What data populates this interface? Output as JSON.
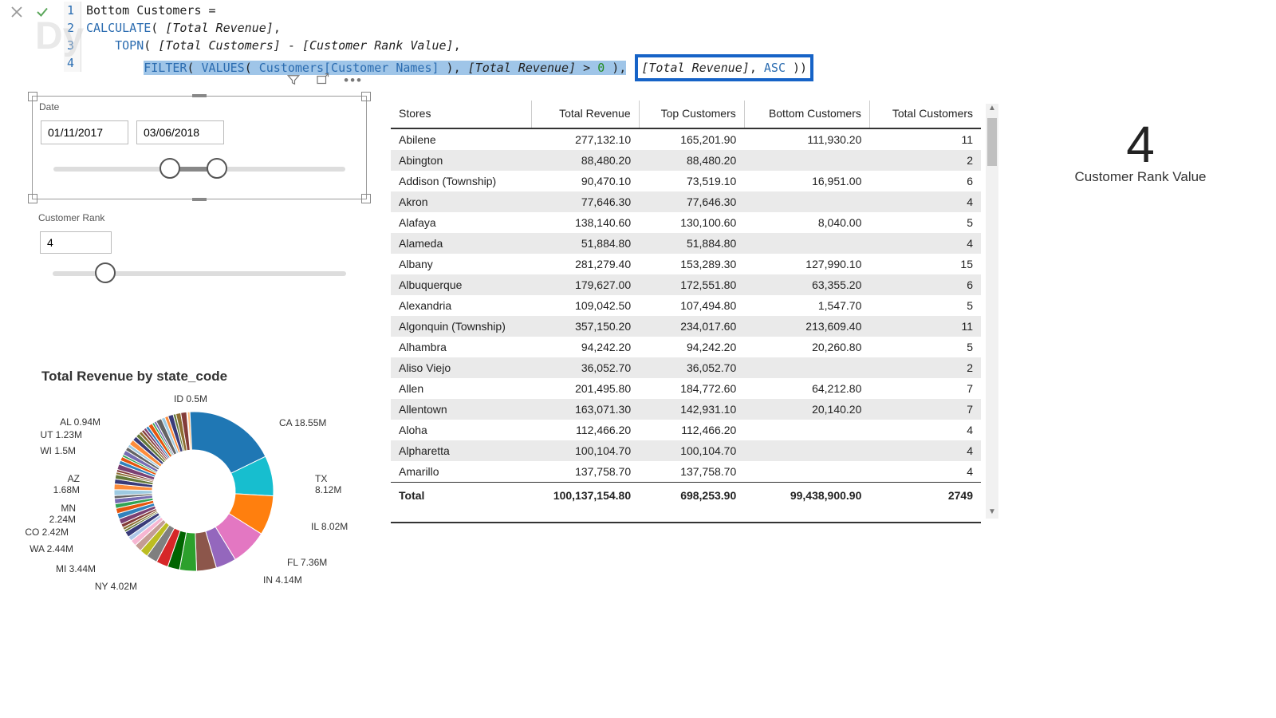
{
  "watermark": "Dy",
  "formula": {
    "line_numbers": [
      "1",
      "2",
      "3",
      "4"
    ],
    "l1_name": "Bottom Customers ",
    "l1_eq": "=",
    "l2_fn": "CALCULATE",
    "l2_paren": "( ",
    "l2_meas": "[Total Revenue]",
    "l2_end": ",",
    "l3_indent": "    ",
    "l3_fn": "TOPN",
    "l3_paren": "( ",
    "l3_a": "[Total Customers]",
    "l3_minus": " - ",
    "l3_b": "[Customer Rank Value]",
    "l3_end": ",",
    "l4_indent": "        ",
    "l4_fn1": "FILTER",
    "l4_p1": "( ",
    "l4_fn2": "VALUES",
    "l4_p2": "( ",
    "l4_col": "Customers[Customer Names]",
    "l4_p2c": " ), ",
    "l4_meas": "[Total Revenue]",
    "l4_gt": " > ",
    "l4_zero": "0",
    "l4_p1c": " ),",
    "l4_box_meas": "[Total Revenue]",
    "l4_box_sep": ", ",
    "l4_box_asc": "ASC",
    "l4_box_end": " ))"
  },
  "slicers": {
    "date_label": "Date",
    "date_from": "01/11/2017",
    "date_to": "03/06/2018",
    "rank_label": "Customer Rank",
    "rank_value": "4"
  },
  "kpi": {
    "value": "4",
    "label": "Customer Rank Value"
  },
  "table": {
    "columns": [
      "Stores",
      "Total Revenue",
      "Top Customers",
      "Bottom Customers",
      "Total Customers"
    ],
    "rows": [
      [
        "Abilene",
        "277,132.10",
        "165,201.90",
        "111,930.20",
        "11"
      ],
      [
        "Abington",
        "88,480.20",
        "88,480.20",
        "",
        "2"
      ],
      [
        "Addison (Township)",
        "90,470.10",
        "73,519.10",
        "16,951.00",
        "6"
      ],
      [
        "Akron",
        "77,646.30",
        "77,646.30",
        "",
        "4"
      ],
      [
        "Alafaya",
        "138,140.60",
        "130,100.60",
        "8,040.00",
        "5"
      ],
      [
        "Alameda",
        "51,884.80",
        "51,884.80",
        "",
        "4"
      ],
      [
        "Albany",
        "281,279.40",
        "153,289.30",
        "127,990.10",
        "15"
      ],
      [
        "Albuquerque",
        "179,627.00",
        "172,551.80",
        "63,355.20",
        "6"
      ],
      [
        "Alexandria",
        "109,042.50",
        "107,494.80",
        "1,547.70",
        "5"
      ],
      [
        "Algonquin (Township)",
        "357,150.20",
        "234,017.60",
        "213,609.40",
        "11"
      ],
      [
        "Alhambra",
        "94,242.20",
        "94,242.20",
        "20,260.80",
        "5"
      ],
      [
        "Aliso Viejo",
        "36,052.70",
        "36,052.70",
        "",
        "2"
      ],
      [
        "Allen",
        "201,495.80",
        "184,772.60",
        "64,212.80",
        "7"
      ],
      [
        "Allentown",
        "163,071.30",
        "142,931.10",
        "20,140.20",
        "7"
      ],
      [
        "Aloha",
        "112,466.20",
        "112,466.20",
        "",
        "4"
      ],
      [
        "Alpharetta",
        "100,104.70",
        "100,104.70",
        "",
        "4"
      ],
      [
        "Amarillo",
        "137,758.70",
        "137,758.70",
        "",
        "4"
      ]
    ],
    "total": [
      "Total",
      "100,137,154.80",
      "698,253.90",
      "99,438,900.90",
      "2749"
    ]
  },
  "chart_data": {
    "type": "pie",
    "title": "Total Revenue by state_code",
    "series": [
      {
        "name": "CA",
        "value": 18.55,
        "label": "CA 18.55M",
        "color": "#1f77b4"
      },
      {
        "name": "TX",
        "value": 8.12,
        "label": "TX 8.12M",
        "color": "#17becf"
      },
      {
        "name": "IL",
        "value": 8.02,
        "label": "IL 8.02M",
        "color": "#ff7f0e"
      },
      {
        "name": "FL",
        "value": 7.36,
        "label": "FL 7.36M",
        "color": "#e377c2"
      },
      {
        "name": "IN",
        "value": 4.14,
        "label": "IN 4.14M",
        "color": "#9467bd"
      },
      {
        "name": "NY",
        "value": 4.02,
        "label": "NY 4.02M",
        "color": "#8c564b"
      },
      {
        "name": "MI",
        "value": 3.44,
        "label": "MI 3.44M",
        "color": "#2ca02c"
      },
      {
        "name": "WA",
        "value": 2.44,
        "label": "WA 2.44M",
        "color": "#006400"
      },
      {
        "name": "CO",
        "value": 2.42,
        "label": "CO 2.42M",
        "color": "#d62728"
      },
      {
        "name": "MN",
        "value": 2.24,
        "label": "MN 2.24M",
        "color": "#7f7f7f"
      },
      {
        "name": "AZ",
        "value": 1.68,
        "label": "AZ 1.68M",
        "color": "#bcbd22"
      },
      {
        "name": "WI",
        "value": 1.5,
        "label": "WI 1.5M",
        "color": "#c49c94"
      },
      {
        "name": "UT",
        "value": 1.23,
        "label": "UT 1.23M",
        "color": "#f7b6d2"
      },
      {
        "name": "AL",
        "value": 0.94,
        "label": "AL 0.94M",
        "color": "#aec7e8"
      },
      {
        "name": "ID",
        "value": 0.5,
        "label": "ID 0.5M",
        "color": "#ffbb78"
      }
    ],
    "other_total": 33.4
  }
}
